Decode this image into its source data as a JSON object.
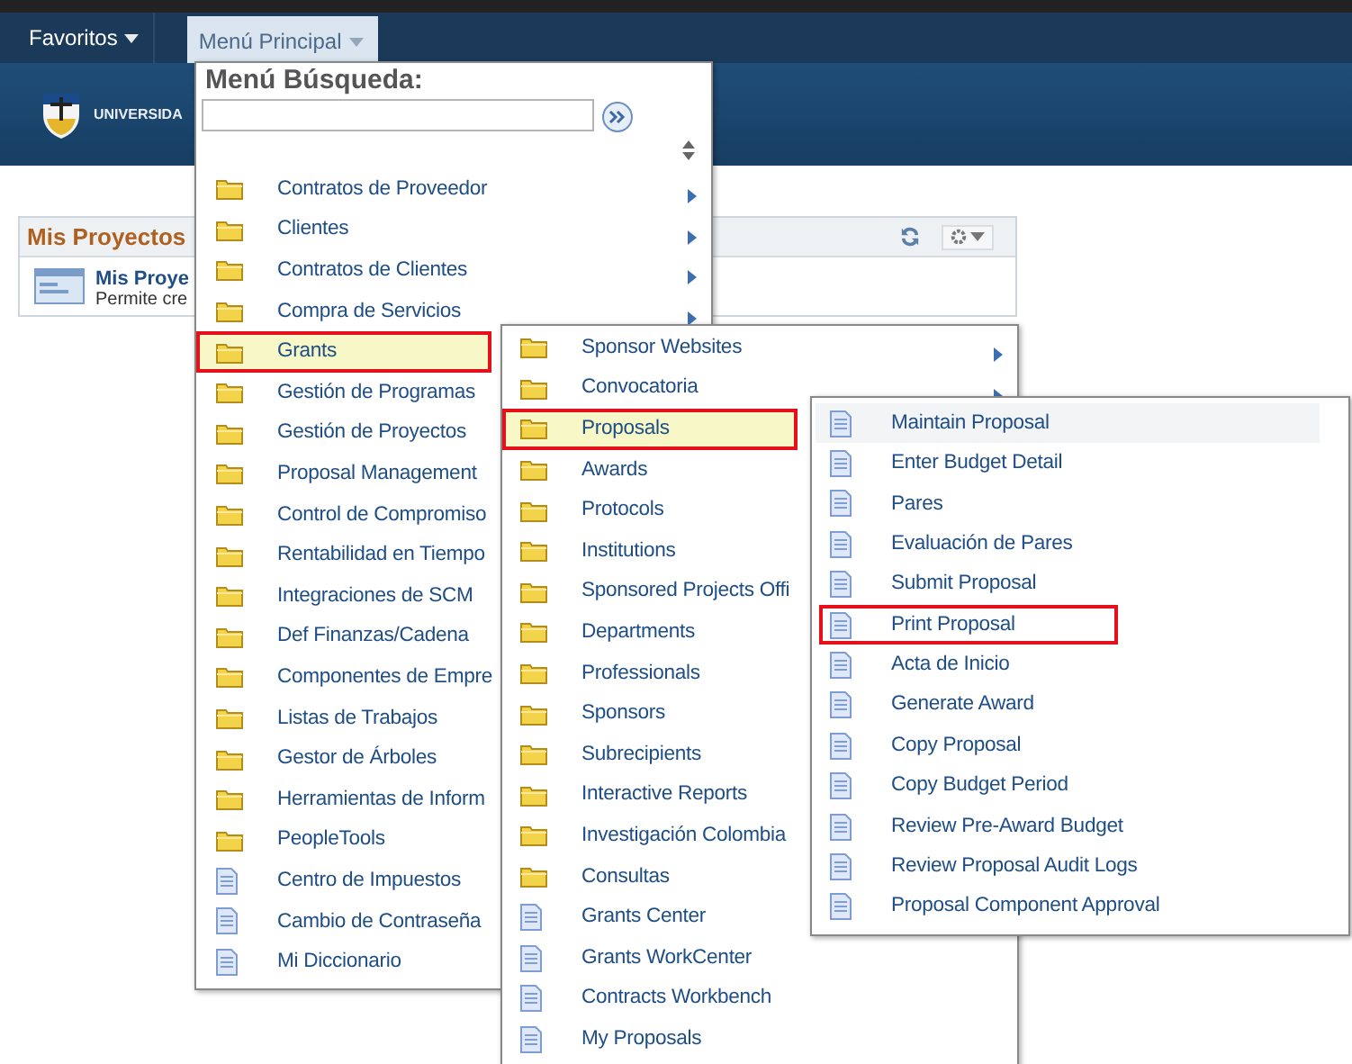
{
  "navbar": {
    "tabs": [
      {
        "label": "Favoritos",
        "selected": false
      },
      {
        "label": "Menú Principal",
        "selected": true
      }
    ]
  },
  "banner": {
    "text": "UNIVERSIDA"
  },
  "portlet": {
    "title": "Mis Proyectos",
    "item_title": "Mis Proye",
    "item_description": "Permite cre"
  },
  "menus": [
    {
      "header": "Menú Búsqueda:",
      "search": true,
      "items": [
        {
          "kind": "folder",
          "label": "Contratos de Proveedor",
          "submenu": true,
          "selected": false,
          "highlighted": false,
          "hovered": false
        },
        {
          "kind": "folder",
          "label": "Clientes",
          "submenu": true,
          "selected": false,
          "highlighted": false,
          "hovered": false
        },
        {
          "kind": "folder",
          "label": "Contratos de Clientes",
          "submenu": true,
          "selected": false,
          "highlighted": false,
          "hovered": false
        },
        {
          "kind": "folder",
          "label": "Compra de Servicios",
          "submenu": true,
          "selected": false,
          "highlighted": false,
          "hovered": false
        },
        {
          "kind": "folder",
          "label": "Grants",
          "submenu": false,
          "selected": true,
          "highlighted": true,
          "hovered": false
        },
        {
          "kind": "folder",
          "label": "Gestión de Programas",
          "submenu": false,
          "selected": false,
          "highlighted": false,
          "hovered": false
        },
        {
          "kind": "folder",
          "label": "Gestión de Proyectos",
          "submenu": false,
          "selected": false,
          "highlighted": false,
          "hovered": false
        },
        {
          "kind": "folder",
          "label": "Proposal Management",
          "submenu": false,
          "selected": false,
          "highlighted": false,
          "hovered": false
        },
        {
          "kind": "folder",
          "label": "Control de Compromiso",
          "submenu": false,
          "selected": false,
          "highlighted": false,
          "hovered": false
        },
        {
          "kind": "folder",
          "label": "Rentabilidad en Tiempo",
          "submenu": false,
          "selected": false,
          "highlighted": false,
          "hovered": false
        },
        {
          "kind": "folder",
          "label": "Integraciones de SCM",
          "submenu": false,
          "selected": false,
          "highlighted": false,
          "hovered": false
        },
        {
          "kind": "folder",
          "label": "Def Finanzas/Cadena",
          "submenu": false,
          "selected": false,
          "highlighted": false,
          "hovered": false
        },
        {
          "kind": "folder",
          "label": "Componentes de Empre",
          "submenu": false,
          "selected": false,
          "highlighted": false,
          "hovered": false
        },
        {
          "kind": "folder",
          "label": "Listas de Trabajos",
          "submenu": false,
          "selected": false,
          "highlighted": false,
          "hovered": false
        },
        {
          "kind": "folder",
          "label": "Gestor de Árboles",
          "submenu": false,
          "selected": false,
          "highlighted": false,
          "hovered": false
        },
        {
          "kind": "folder",
          "label": "Herramientas de Inform",
          "submenu": false,
          "selected": false,
          "highlighted": false,
          "hovered": false
        },
        {
          "kind": "folder",
          "label": "PeopleTools",
          "submenu": false,
          "selected": false,
          "highlighted": false,
          "hovered": false
        },
        {
          "kind": "page",
          "label": "Centro de Impuestos",
          "submenu": false,
          "selected": false,
          "highlighted": false,
          "hovered": false
        },
        {
          "kind": "page",
          "label": "Cambio de Contraseña",
          "submenu": false,
          "selected": false,
          "highlighted": false,
          "hovered": false
        },
        {
          "kind": "page",
          "label": "Mi Diccionario",
          "submenu": false,
          "selected": false,
          "highlighted": false,
          "hovered": false
        }
      ]
    },
    {
      "items": [
        {
          "kind": "folder",
          "label": "Sponsor Websites",
          "submenu": true,
          "selected": false,
          "highlighted": false,
          "hovered": false
        },
        {
          "kind": "folder",
          "label": "Convocatoria",
          "submenu": true,
          "selected": false,
          "highlighted": false,
          "hovered": false
        },
        {
          "kind": "folder",
          "label": "Proposals",
          "submenu": false,
          "selected": true,
          "highlighted": true,
          "hovered": false
        },
        {
          "kind": "folder",
          "label": "Awards",
          "submenu": false,
          "selected": false,
          "highlighted": false,
          "hovered": false
        },
        {
          "kind": "folder",
          "label": "Protocols",
          "submenu": false,
          "selected": false,
          "highlighted": false,
          "hovered": false
        },
        {
          "kind": "folder",
          "label": "Institutions",
          "submenu": false,
          "selected": false,
          "highlighted": false,
          "hovered": false
        },
        {
          "kind": "folder",
          "label": "Sponsored Projects Offi",
          "submenu": false,
          "selected": false,
          "highlighted": false,
          "hovered": false
        },
        {
          "kind": "folder",
          "label": "Departments",
          "submenu": false,
          "selected": false,
          "highlighted": false,
          "hovered": false
        },
        {
          "kind": "folder",
          "label": "Professionals",
          "submenu": false,
          "selected": false,
          "highlighted": false,
          "hovered": false
        },
        {
          "kind": "folder",
          "label": "Sponsors",
          "submenu": false,
          "selected": false,
          "highlighted": false,
          "hovered": false
        },
        {
          "kind": "folder",
          "label": "Subrecipients",
          "submenu": false,
          "selected": false,
          "highlighted": false,
          "hovered": false
        },
        {
          "kind": "folder",
          "label": "Interactive Reports",
          "submenu": false,
          "selected": false,
          "highlighted": false,
          "hovered": false
        },
        {
          "kind": "folder",
          "label": "Investigación Colombia",
          "submenu": false,
          "selected": false,
          "highlighted": false,
          "hovered": false
        },
        {
          "kind": "folder",
          "label": "Consultas",
          "submenu": false,
          "selected": false,
          "highlighted": false,
          "hovered": false
        },
        {
          "kind": "page",
          "label": "Grants Center",
          "submenu": false,
          "selected": false,
          "highlighted": false,
          "hovered": false
        },
        {
          "kind": "page",
          "label": "Grants WorkCenter",
          "submenu": false,
          "selected": false,
          "highlighted": false,
          "hovered": false
        },
        {
          "kind": "page",
          "label": "Contracts Workbench",
          "submenu": false,
          "selected": false,
          "highlighted": false,
          "hovered": false
        },
        {
          "kind": "page",
          "label": "My Proposals",
          "submenu": false,
          "selected": false,
          "highlighted": false,
          "hovered": false
        }
      ]
    },
    {
      "items": [
        {
          "kind": "page",
          "label": "Maintain Proposal",
          "submenu": false,
          "selected": false,
          "highlighted": false,
          "hovered": true
        },
        {
          "kind": "page",
          "label": "Enter Budget Detail",
          "submenu": false,
          "selected": false,
          "highlighted": false,
          "hovered": false
        },
        {
          "kind": "page",
          "label": "Pares",
          "submenu": false,
          "selected": false,
          "highlighted": false,
          "hovered": false
        },
        {
          "kind": "page",
          "label": "Evaluación de Pares",
          "submenu": false,
          "selected": false,
          "highlighted": false,
          "hovered": false
        },
        {
          "kind": "page",
          "label": "Submit Proposal",
          "submenu": false,
          "selected": false,
          "highlighted": false,
          "hovered": false
        },
        {
          "kind": "page",
          "label": "Print Proposal",
          "submenu": false,
          "selected": false,
          "highlighted": true,
          "hovered": false
        },
        {
          "kind": "page",
          "label": "Acta de Inicio",
          "submenu": false,
          "selected": false,
          "highlighted": false,
          "hovered": false
        },
        {
          "kind": "page",
          "label": "Generate Award",
          "submenu": false,
          "selected": false,
          "highlighted": false,
          "hovered": false
        },
        {
          "kind": "page",
          "label": "Copy Proposal",
          "submenu": false,
          "selected": false,
          "highlighted": false,
          "hovered": false
        },
        {
          "kind": "page",
          "label": "Copy Budget Period",
          "submenu": false,
          "selected": false,
          "highlighted": false,
          "hovered": false
        },
        {
          "kind": "page",
          "label": "Review Pre-Award Budget",
          "submenu": false,
          "selected": false,
          "highlighted": false,
          "hovered": false
        },
        {
          "kind": "page",
          "label": "Review Proposal Audit Logs",
          "submenu": false,
          "selected": false,
          "highlighted": false,
          "hovered": false
        },
        {
          "kind": "page",
          "label": "Proposal Component Approval",
          "submenu": false,
          "selected": false,
          "highlighted": false,
          "hovered": false
        }
      ]
    }
  ]
}
